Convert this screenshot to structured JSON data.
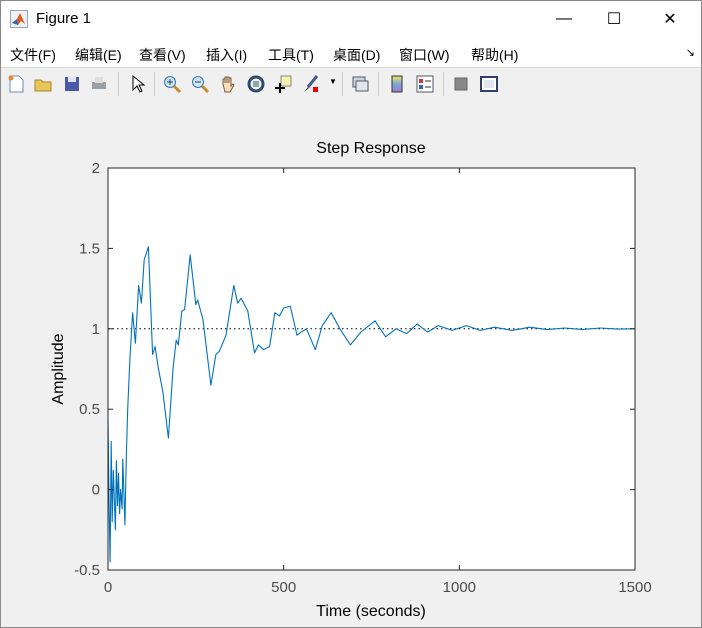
{
  "window": {
    "title": "Figure 1",
    "minimize": "—",
    "maximize": "☐",
    "close": "✕"
  },
  "menu": [
    "文件(F)",
    "编辑(E)",
    "查看(V)",
    "插入(I)",
    "工具(T)",
    "桌面(D)",
    "窗口(W)",
    "帮助(H)"
  ],
  "menu_overflow": "↘",
  "toolbar": [
    "new-figure",
    "open-file",
    "save",
    "print",
    "edit-plot",
    "zoom-in",
    "zoom-out",
    "pan",
    "rotate-3d",
    "data-cursor",
    "brush",
    "link-plot",
    "insert-colorbar",
    "insert-legend",
    "hide-plot-tools",
    "show-plot-tools"
  ],
  "colors": {
    "line": "#0072bd",
    "axis": "#262626",
    "tick_label": "#4d4d4d"
  },
  "chart_data": {
    "type": "line",
    "title": "Step Response",
    "xlabel": "Time (seconds)",
    "ylabel": "Amplitude",
    "xlim": [
      0,
      1500
    ],
    "ylim": [
      -0.5,
      2
    ],
    "xticks": [
      "0",
      "500",
      "1000",
      "1500"
    ],
    "xtick_values": [
      0,
      500,
      1000,
      1500
    ],
    "yticks": [
      "-0.5",
      "0",
      "0.5",
      "1",
      "1.5",
      "2"
    ],
    "ytick_values": [
      -0.5,
      0,
      0.5,
      1,
      1.5,
      2
    ],
    "grid": false,
    "reference_line": {
      "value": 1,
      "style": "dotted"
    },
    "series": [
      {
        "name": "step response",
        "x": [
          0,
          3,
          6,
          9,
          12,
          15,
          18,
          21,
          24,
          27,
          30,
          33,
          36,
          40,
          42,
          45,
          48,
          52,
          56,
          62,
          70,
          78,
          87,
          95,
          103,
          115,
          127,
          134,
          143,
          156,
          172,
          185,
          194,
          200,
          210,
          218,
          234,
          250,
          255,
          270,
          293,
          307,
          317,
          336,
          358,
          369,
          379,
          398,
          417,
          428,
          443,
          460,
          475,
          488,
          500,
          519,
          538,
          550,
          565,
          590,
          610,
          635,
          660,
          690,
          720,
          760,
          790,
          820,
          850,
          880,
          910,
          940,
          980,
          1020,
          1060,
          1100,
          1150,
          1200,
          1250,
          1300,
          1350,
          1400,
          1450,
          1500
        ],
        "y": [
          0.44,
          -0.1,
          -0.45,
          0.3,
          -0.2,
          0.12,
          -0.05,
          -0.25,
          0.18,
          -0.1,
          0.1,
          -0.15,
          0.0,
          -0.12,
          0.19,
          0.0,
          -0.22,
          0.2,
          0.5,
          0.8,
          1.1,
          0.91,
          1.27,
          1.16,
          1.43,
          1.51,
          0.84,
          0.89,
          0.76,
          0.61,
          0.32,
          0.75,
          0.93,
          0.9,
          1.11,
          1.12,
          1.46,
          1.15,
          1.18,
          1.06,
          0.65,
          0.84,
          0.86,
          0.96,
          1.27,
          1.16,
          1.19,
          1.11,
          0.85,
          0.9,
          0.87,
          0.89,
          1.1,
          1.08,
          1.13,
          1.14,
          0.96,
          0.98,
          1.0,
          0.87,
          1.02,
          1.1,
          1.0,
          0.9,
          0.98,
          1.05,
          0.95,
          1.0,
          0.97,
          1.03,
          0.98,
          1.02,
          0.99,
          1.02,
          0.99,
          1.01,
          0.99,
          1.01,
          0.995,
          1.005,
          0.995,
          1.005,
          0.998,
          1.0
        ]
      }
    ]
  }
}
